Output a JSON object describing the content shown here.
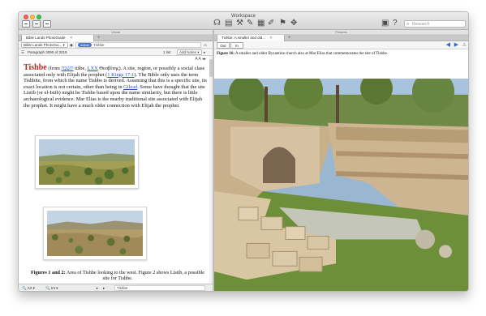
{
  "window": {
    "title": "Workspace"
  },
  "toolbar": {
    "search_placeholder": "Research",
    "icons": [
      "home-icon",
      "library-icon",
      "calendar-icon",
      "guides-icon",
      "documents-icon",
      "tools-icon",
      "notes-icon",
      "highlight-icon",
      "compose-icon",
      "bookmark-icon",
      "layouts-icon",
      "help-icon"
    ]
  },
  "left_pane": {
    "label": "Visual",
    "tab_label": "Bible Lands PhotoGuide",
    "resource_dropdown": "Bible Lands PhotoGui...",
    "reference_chip": "Article",
    "reference_text": "Tishbe",
    "paragraph_status": "Paragraph 3090 of 3219",
    "font_size_label": "A A",
    "lookup": "1 list",
    "notes_button": "Add Notes",
    "headword": "Tishbe",
    "body_pre": " (from ",
    "hebrew": "תִּשְׁבֶּה",
    "body_mid1": " tišbe, ",
    "lxx": "LXX",
    "greek": " Θεσβίτης",
    "body_mid2": "). A site, region, or possibly a social class associated only with Elijah the prophet (",
    "ref_1kings": "1 Kings 17:1",
    "body_mid3": "). The Bible only uses the term Tishbite, from which the name Tishbe is derived. Assuming that this is a specific site, its exact location is not certain, other than being in ",
    "gilead": "Gilead",
    "body_end": ". Some have thought that the site Listib (or el-Istib) might be Tishbe based upon the name similarity, but there is little archaeological evidence. Mar Elias is the nearby traditional site associated with Elijah the prophet. It might have a much older connection with Elijah the prophet.",
    "caption_bold": "Figures 1 and 2:",
    "caption_text": " Area of Tishbe looking to the west. Figure 2 shows Listib, a possible site for Tishbe.",
    "bottom_left": "Art",
    "bottom_mid": "Int",
    "bottom_field": "Tishbe"
  },
  "right_pane": {
    "label": "Pictures",
    "tab_label": "Tishbe: A smaller and old...",
    "seg_out": "Out",
    "seg_in": "In",
    "figure_caption_bold": "Figure 16:",
    "figure_caption_text": " A smaller and older Byzantine church also at Mar Elias that commemorates the site of Tishbe."
  }
}
